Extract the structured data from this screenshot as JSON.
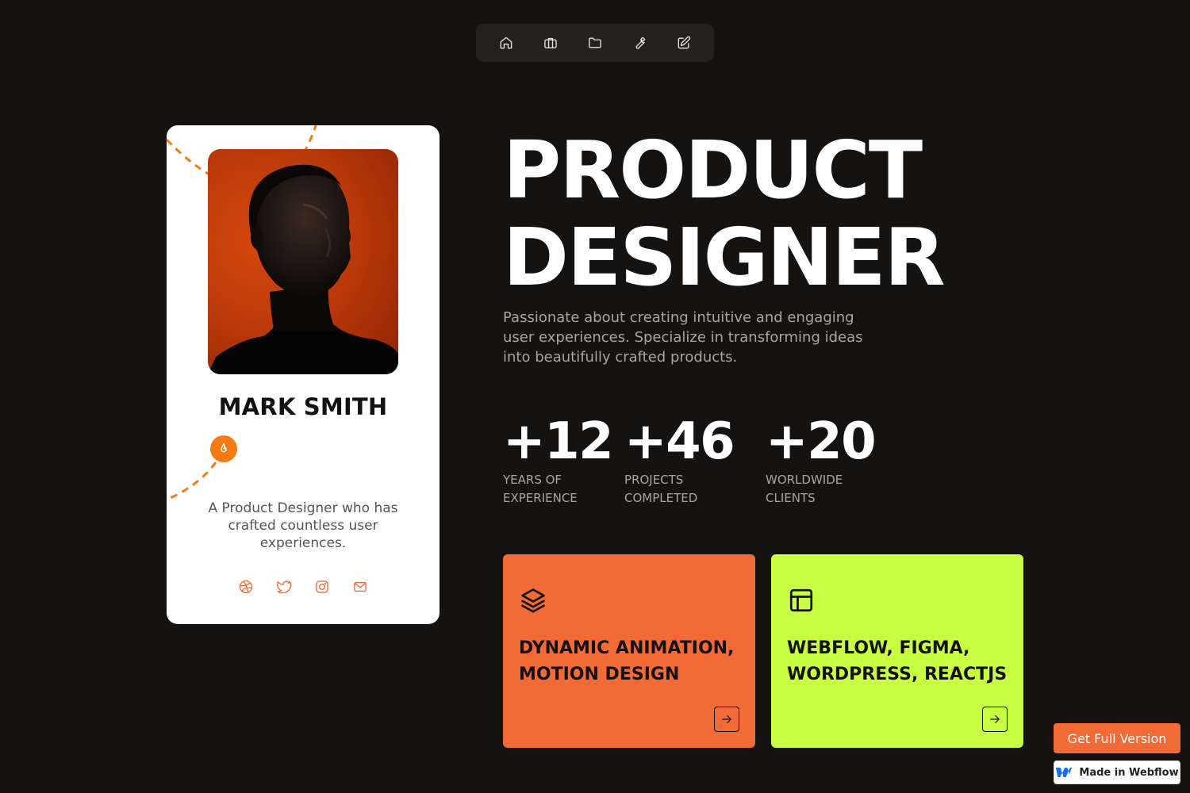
{
  "nav": {
    "items": [
      {
        "icon": "home-icon"
      },
      {
        "icon": "briefcase-icon"
      },
      {
        "icon": "folder-icon"
      },
      {
        "icon": "wrench-icon"
      },
      {
        "icon": "edit-icon"
      }
    ]
  },
  "profile": {
    "name": "MARK SMITH",
    "bio": "A Product Designer who has crafted countless user experiences.",
    "badge_icon": "flame-icon",
    "socials": [
      {
        "icon": "dribbble-icon"
      },
      {
        "icon": "twitter-icon"
      },
      {
        "icon": "instagram-icon"
      },
      {
        "icon": "mail-icon"
      }
    ],
    "accent_color": "#f47b14"
  },
  "hero": {
    "title_line1": "PRODUCT",
    "title_line2": "DESIGNER",
    "description": "Passionate about creating intuitive and engaging user experiences. Specialize in transforming ideas into beautifully crafted products."
  },
  "stats": [
    {
      "value": "+12",
      "label_line1": "YEARS OF",
      "label_line2": "EXPERIENCE"
    },
    {
      "value": "+46",
      "label_line1": "PROJECTS",
      "label_line2": "COMPLETED"
    },
    {
      "value": "+20",
      "label_line1": "WORLDWIDE",
      "label_line2": "CLIENTS"
    }
  ],
  "skills": [
    {
      "icon": "layers-icon",
      "line1": "DYNAMIC ANIMATION,",
      "line2": "MOTION DESIGN",
      "color": "#f26a36"
    },
    {
      "icon": "layout-icon",
      "line1": "WEBFLOW, FIGMA,",
      "line2": "WORDPRESS, REACTJS",
      "color": "#c9ff43"
    }
  ],
  "cta": {
    "get_full_version": "Get Full Version",
    "made_in_webflow": "Made in Webflow"
  },
  "colors": {
    "background": "#151312",
    "orange": "#f26a36",
    "lime": "#c9ff43"
  }
}
